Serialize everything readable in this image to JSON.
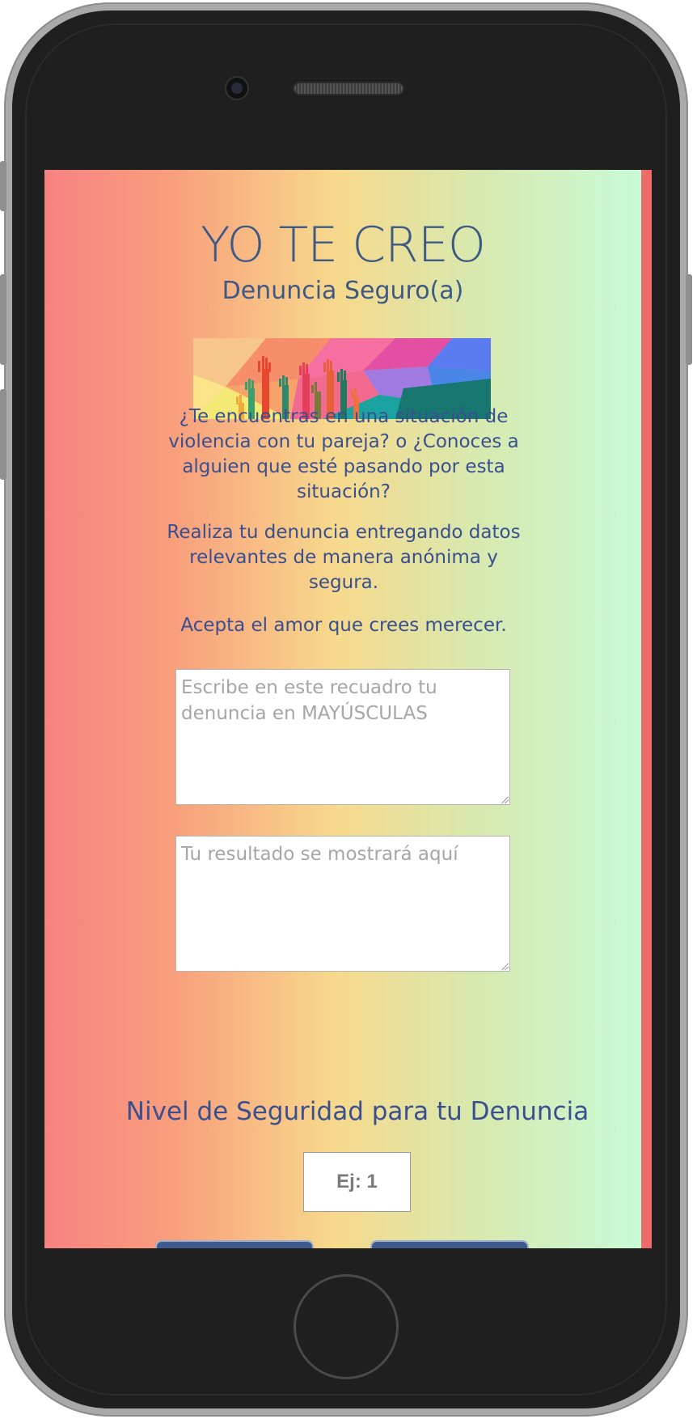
{
  "app": {
    "title": "YO TE CREO",
    "subtitle": "Denuncia Seguro(a)"
  },
  "intro": {
    "question": "¿Te encuentras en una situación de violencia con tu pareja? o ¿Conoces a alguien que esté pasando por esta situación?",
    "instruction": "Realiza tu denuncia entregando datos relevantes de manera anónima y segura.",
    "motto": "Acepta el amor que crees merecer."
  },
  "form": {
    "complaint_placeholder": "Escribe en este recuadro tu denuncia en MAYÚSCULAS",
    "complaint_value": "",
    "result_placeholder": "Tu resultado se mostrará aquí",
    "result_value": "",
    "security_level_label": "Nivel de Seguridad para tu Denuncia",
    "security_level_placeholder": "Ej: 1",
    "security_level_value": ""
  },
  "colors": {
    "text_primary": "#3d5a85",
    "gradient": [
      "#f78282",
      "#f7d98c",
      "#c6fbd8"
    ],
    "button": "#3e5a8e"
  },
  "icons": {
    "banner": "raised-hands-banner-icon",
    "camera": "front-camera-icon",
    "speaker": "speaker-grille-icon",
    "home": "home-button-icon"
  }
}
